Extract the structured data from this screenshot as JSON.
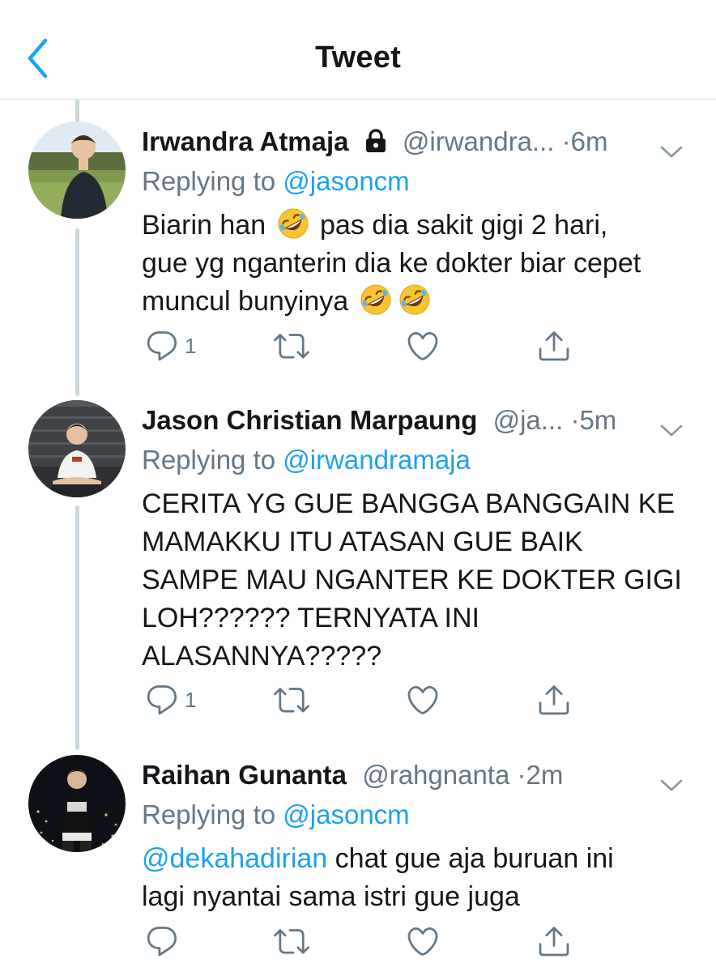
{
  "header": {
    "title": "Tweet"
  },
  "tweets": [
    {
      "name": "Irwandra Atmaja",
      "handle": "@irwandra...",
      "time": "·6m",
      "replying_prefix": "Replying to",
      "replying_to": "@jasoncm",
      "text_lines": [
        "Biarin han",
        "pas dia sakit gigi 2 hari,",
        "gue yg nganterin dia ke dokter biar cepet",
        "muncul bunyinya"
      ],
      "reply_count": "1",
      "locked": true
    },
    {
      "name": "Jason Christian Marpaung",
      "handle": "@ja...",
      "time": "·5m",
      "replying_prefix": "Replying to",
      "replying_to": "@irwandramaja",
      "text_lines": [
        "CERITA YG GUE BANGGA BANGGAIN KE",
        "MAMAKKU ITU ATASAN GUE BAIK",
        "SAMPE MAU NGANTER KE DOKTER GIGI",
        "LOH?????? TERNYATA INI",
        "ALASANNYA?????"
      ],
      "reply_count": "1"
    },
    {
      "name": "Raihan Gunanta",
      "handle": "@rahgnanta",
      "time": "·2m",
      "replying_prefix": "Replying to",
      "replying_to": "@jasoncm",
      "mention": "@dekahadirian",
      "text_lines": [
        "chat gue aja buruan ini",
        "lagi nyantai sama istri gue juga"
      ],
      "reply_count": ""
    }
  ],
  "icons": {
    "back": "chevron-left-icon",
    "lock": "lock-icon",
    "menu": "chevron-down-icon",
    "reply": "reply-icon",
    "retweet": "retweet-icon",
    "like": "heart-icon",
    "share": "share-icon",
    "emoji": "rolling-on-the-floor-laughing-emoji"
  },
  "colors": {
    "accent": "#1da1f2",
    "secondary_text": "#657786",
    "icon": "#657786",
    "thread_line": "#ccd6dd"
  }
}
